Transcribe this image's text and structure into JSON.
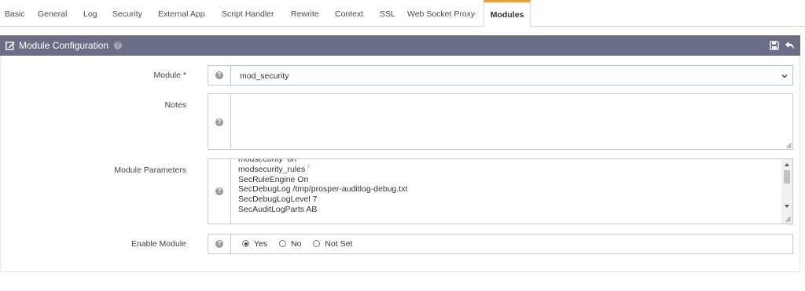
{
  "tabs": [
    {
      "label": "Basic"
    },
    {
      "label": "General"
    },
    {
      "label": "Log"
    },
    {
      "label": "Security"
    },
    {
      "label": "External App"
    },
    {
      "label": "Script Handler"
    },
    {
      "label": "Rewrite"
    },
    {
      "label": "Context"
    },
    {
      "label": "SSL"
    },
    {
      "label": "Web Socket Proxy"
    },
    {
      "label": "Modules",
      "active": true
    }
  ],
  "panel": {
    "title": "Module Configuration",
    "icons": [
      "edit-icon",
      "help-icon",
      "save-icon",
      "back-icon"
    ],
    "header_color": "#6a6d86",
    "accent_color": "#e8a33c"
  },
  "form": {
    "module": {
      "label": "Module *",
      "value": "mod_security"
    },
    "notes": {
      "label": "Notes",
      "value": ""
    },
    "params": {
      "label": "Module Parameters",
      "value": "modsecurity  on\nmodsecurity_rules `\nSecRuleEngine On\nSecDebugLog /tmp/prosper-auditlog-debug.txt\nSecDebugLogLevel 7\nSecAuditLogParts AB"
    },
    "enable": {
      "label": "Enable Module",
      "options": [
        "Yes",
        "No",
        "Not Set"
      ],
      "selected": "Yes"
    }
  }
}
